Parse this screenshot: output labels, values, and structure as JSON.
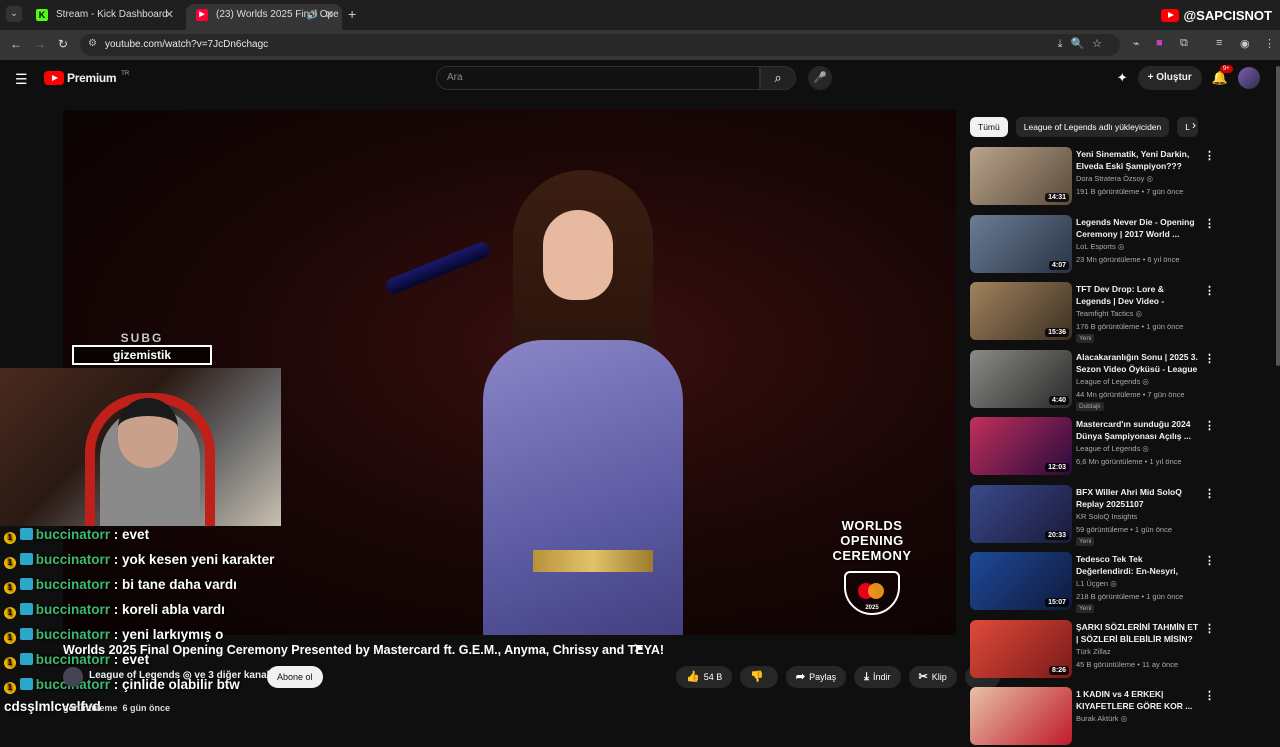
{
  "browser": {
    "tabs": [
      {
        "title": "Stream - Kick Dashboard",
        "favicon": "K"
      },
      {
        "title": "(23) Worlds 2025 Final Ope",
        "favicon": "▶"
      }
    ],
    "url": "youtube.com/watch?v=7JcDn6chagc"
  },
  "stream_badge": "@SAPCISNOT",
  "header": {
    "brand": "Premium",
    "region": "TR",
    "search_placeholder": "Ara",
    "create_label": "Oluştur",
    "notifications": "9+"
  },
  "player": {
    "overlay_logo": {
      "line1": "WORLDS",
      "line2": "OPENING CEREMONY",
      "year": "2025"
    }
  },
  "overlay": {
    "sub_goal_title": "SUBG",
    "sub_goal_name": "gizemistik",
    "chat": [
      {
        "badge": "1",
        "user": "buccinatorr",
        "message": ": evet"
      },
      {
        "badge": "1",
        "user": "buccinatorr",
        "message": ": yok kesen yeni karakter"
      },
      {
        "badge": "1",
        "user": "buccinatorr",
        "message": ": bi tane daha vardı"
      },
      {
        "badge": "1",
        "user": "buccinatorr",
        "message": ": koreli abla vardı"
      },
      {
        "badge": "1",
        "user": "buccinatorr",
        "message": ": yeni larkıymış o"
      },
      {
        "badge": "1",
        "user": "buccinatorr",
        "message": ": evet"
      },
      {
        "badge": "1",
        "user": "buccinatorr",
        "message": ": çinlide olabilir btw"
      }
    ],
    "bottom_text": "cdsşlmlcvslfvd"
  },
  "video": {
    "title": "Worlds 2025 Final Opening Ceremony Presented by Mastercard ft. G.E.M., Anyma, Chrissy and TEYA!",
    "channel": "League of Legends ◎ ve 3 diğer kanal",
    "subscribe": "Abone ol",
    "likes": "54 B",
    "share": "Paylaş",
    "download": "İndir",
    "clip": "Klip",
    "views": "görüntüleme",
    "date": "6 gün önce"
  },
  "sidebar": {
    "chips": [
      "Tümü",
      "League of Legends adlı yükleyiciden",
      "L"
    ],
    "recommendations": [
      {
        "title": "Yeni Sinematik, Yeni Darkin, Elveda Eski Şampiyon???",
        "channel": "Dora Stratera Özsoy ◎",
        "meta": "191 B görüntüleme • 7 gün önce",
        "duration": "14:31",
        "tag": "",
        "colors": [
          "#b9a48c",
          "#5a4a3a"
        ]
      },
      {
        "title": "Legends Never Die - Opening Ceremony | 2017 World ...",
        "channel": "LoL Esports ◎",
        "meta": "23 Mn görüntüleme • 6 yıl önce",
        "duration": "4:07",
        "tag": "",
        "colors": [
          "#6a7d95",
          "#2a3344"
        ]
      },
      {
        "title": "TFT Dev Drop: Lore & Legends | Dev Video - Teamfight Tactics",
        "channel": "Teamfight Tactics ◎",
        "meta": "176 B görüntüleme • 1 gün önce",
        "duration": "15:36",
        "tag": "Yeni",
        "colors": [
          "#a2835e",
          "#3b2f22"
        ]
      },
      {
        "title": "Alacakaranlığın Sonu | 2025 3. Sezon Video Öyküsü - League ...",
        "channel": "League of Legends ◎",
        "meta": "44 Mn görüntüleme • 7 gün önce",
        "duration": "4:40",
        "tag": "Dublajlı",
        "colors": [
          "#8b8a86",
          "#2a2a2a"
        ]
      },
      {
        "title": "Mastercard'ın sunduğu 2024 Dünya Şampiyonası Açılış ...",
        "channel": "League of Legends ◎",
        "meta": "6,6 Mn görüntüleme • 1 yıl önce",
        "duration": "12:03",
        "tag": "",
        "colors": [
          "#c0305a",
          "#2a0a40"
        ]
      },
      {
        "title": "BFX Willer Ahri Mid SoloQ Replay 20251107",
        "channel": "KR SoloQ Insights",
        "meta": "59 görüntüleme • 1 gün önce",
        "duration": "20:33",
        "tag": "Yeni",
        "colors": [
          "#3a4a8a",
          "#1a1a3a"
        ]
      },
      {
        "title": "Tedesco Tek Tek Değerlendirdi: En-Nesyri, Duran, Brown, İrfan ...",
        "channel": "L1 Üçgen ◎",
        "meta": "218 B görüntüleme • 1 gün önce",
        "duration": "15:07",
        "tag": "Yeni",
        "colors": [
          "#1e4a9a",
          "#0e1a3a"
        ]
      },
      {
        "title": "ŞARKI SÖZLERİNİ TAHMİN ET | SÖZLERİ BİLEBİLİR MİSİN? 🔥 ...",
        "channel": "Türk Zillaz",
        "meta": "45 B görüntüleme • 11 ay önce",
        "duration": "8:26",
        "tag": "",
        "colors": [
          "#e04a3a",
          "#7a1a1a"
        ]
      },
      {
        "title": "1 KADIN vs 4 ERKEK| KIYAFETLERE GÖRE KOR ...",
        "channel": "Burak Aktürk ◎",
        "meta": "",
        "duration": "",
        "tag": "",
        "colors": [
          "#e8c0a8",
          "#c01a2a"
        ]
      }
    ]
  }
}
